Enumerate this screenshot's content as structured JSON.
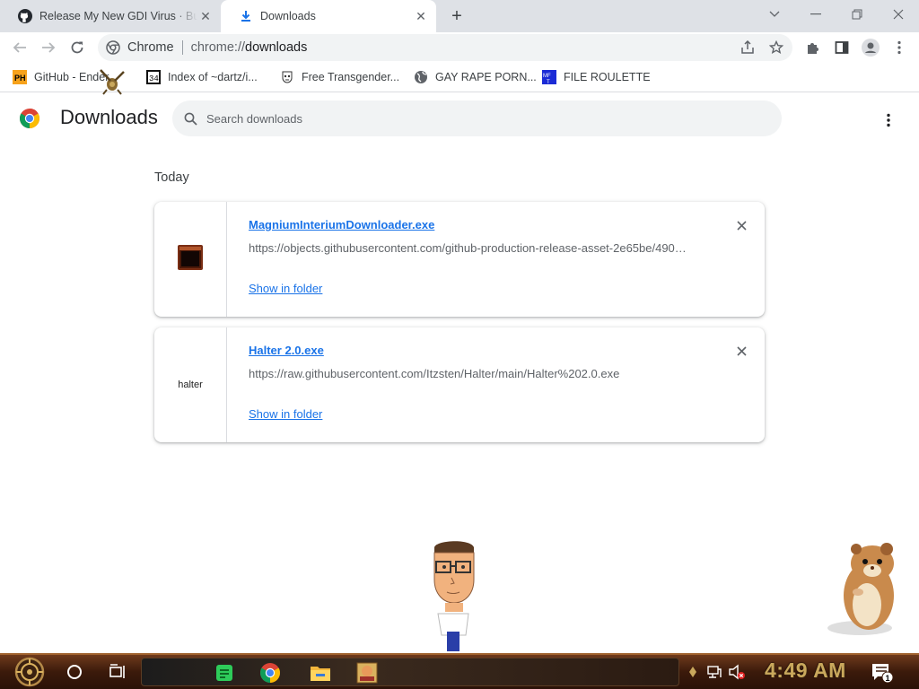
{
  "tabs": [
    {
      "title": "Release My New GDI Virus · Bu",
      "icon": "github-icon",
      "active": false
    },
    {
      "title": "Downloads",
      "icon": "download-icon",
      "active": true
    }
  ],
  "window_controls": [
    "chevron-down-icon",
    "minimize-icon",
    "restore-icon",
    "close-icon"
  ],
  "toolbar": {
    "site_label": "Chrome",
    "url_scheme": "chrome://",
    "url_path": "downloads"
  },
  "bookmarks": [
    {
      "label": "GitHub - Ender...",
      "icon": "ph-icon"
    },
    {
      "label": "Index of ~dartz/i...",
      "icon": "dartz-icon"
    },
    {
      "label": "Free Transgender...",
      "icon": "mask-icon"
    },
    {
      "label": "GAY RAPE PORN...",
      "icon": "globe-icon"
    },
    {
      "label": "FILE ROULETTE",
      "icon": "mft-icon"
    }
  ],
  "downloads_page": {
    "title": "Downloads",
    "search_placeholder": "Search downloads",
    "section_label": "Today",
    "items": [
      {
        "file_name": "MagniumInteriumDownloader.exe",
        "url": "https://objects.githubusercontent.com/github-production-release-asset-2e65be/490…",
        "action_label": "Show in folder",
        "icon": "exe-window-icon"
      },
      {
        "file_name": "Halter 2.0.exe",
        "url": "https://raw.githubusercontent.com/Itzsten/Halter/main/Halter%202.0.exe",
        "action_label": "Show in folder",
        "icon_text": "halter"
      }
    ]
  },
  "taskbar": {
    "apps": [
      "green-app-icon",
      "chrome-icon",
      "file-explorer-icon",
      "game-box-icon"
    ],
    "clock": "4:49 AM",
    "notification_count": "1"
  },
  "colors": {
    "link_blue": "#1a73e8",
    "tabstrip": "#dee1e6",
    "clock_gold": "#c9a85c"
  }
}
